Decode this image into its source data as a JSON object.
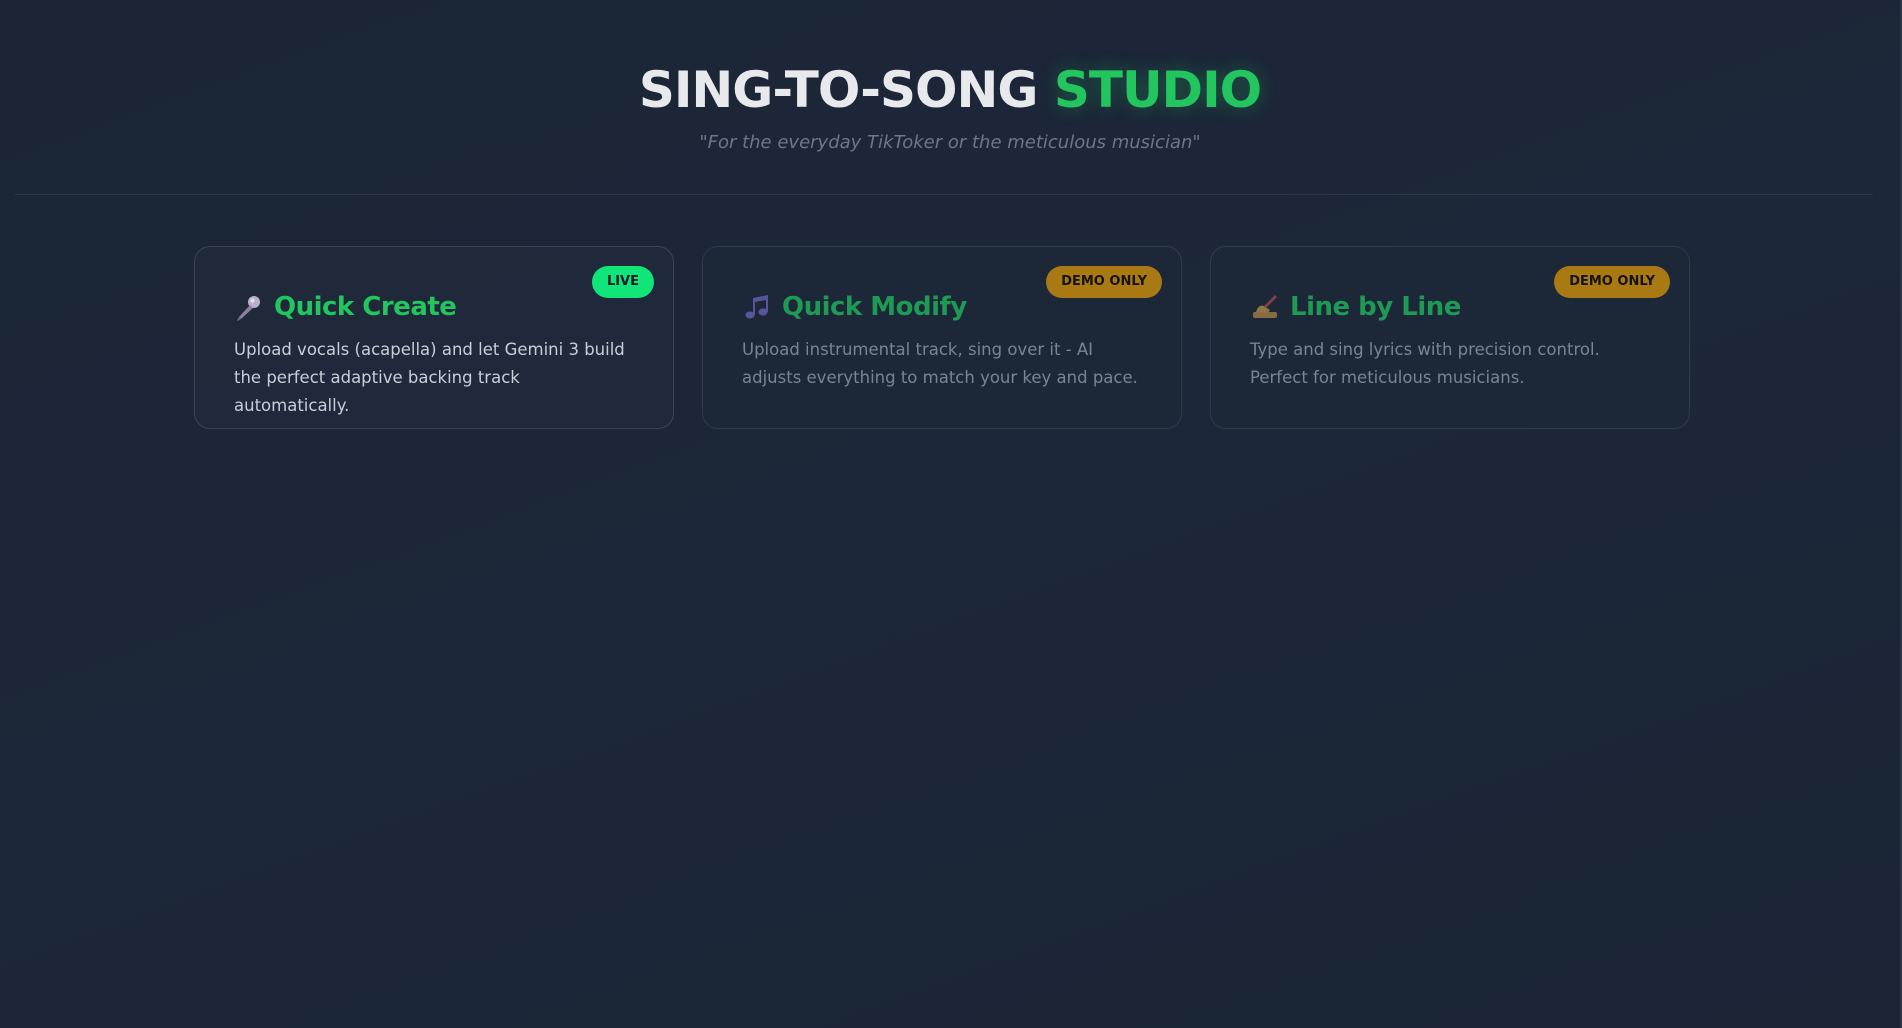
{
  "header": {
    "title_part1": "SING-TO-SONG",
    "title_part2": "STUDIO",
    "subtitle": "\"For the everyday TikToker or the meticulous musician\""
  },
  "modes": [
    {
      "icon": "microphone-icon",
      "title": "Quick Create",
      "badge": "LIVE",
      "description": "Upload vocals (acapella) and let Gemini 3 build the perfect adaptive backing track automatically."
    },
    {
      "icon": "music-note-icon",
      "title": "Quick Modify",
      "badge": "DEMO ONLY",
      "description": "Upload instrumental track, sing over it - AI adjusts everything to match your key and pace."
    },
    {
      "icon": "writing-hand-icon",
      "title": "Line by Line",
      "badge": "DEMO ONLY",
      "description": "Type and sing lyrics with precision control. Perfect for meticulous musicians."
    }
  ],
  "colors": {
    "accent": "#22c55e",
    "live_badge": "#10e57a",
    "demo_badge": "#a97a14",
    "background": "#1c2739"
  }
}
